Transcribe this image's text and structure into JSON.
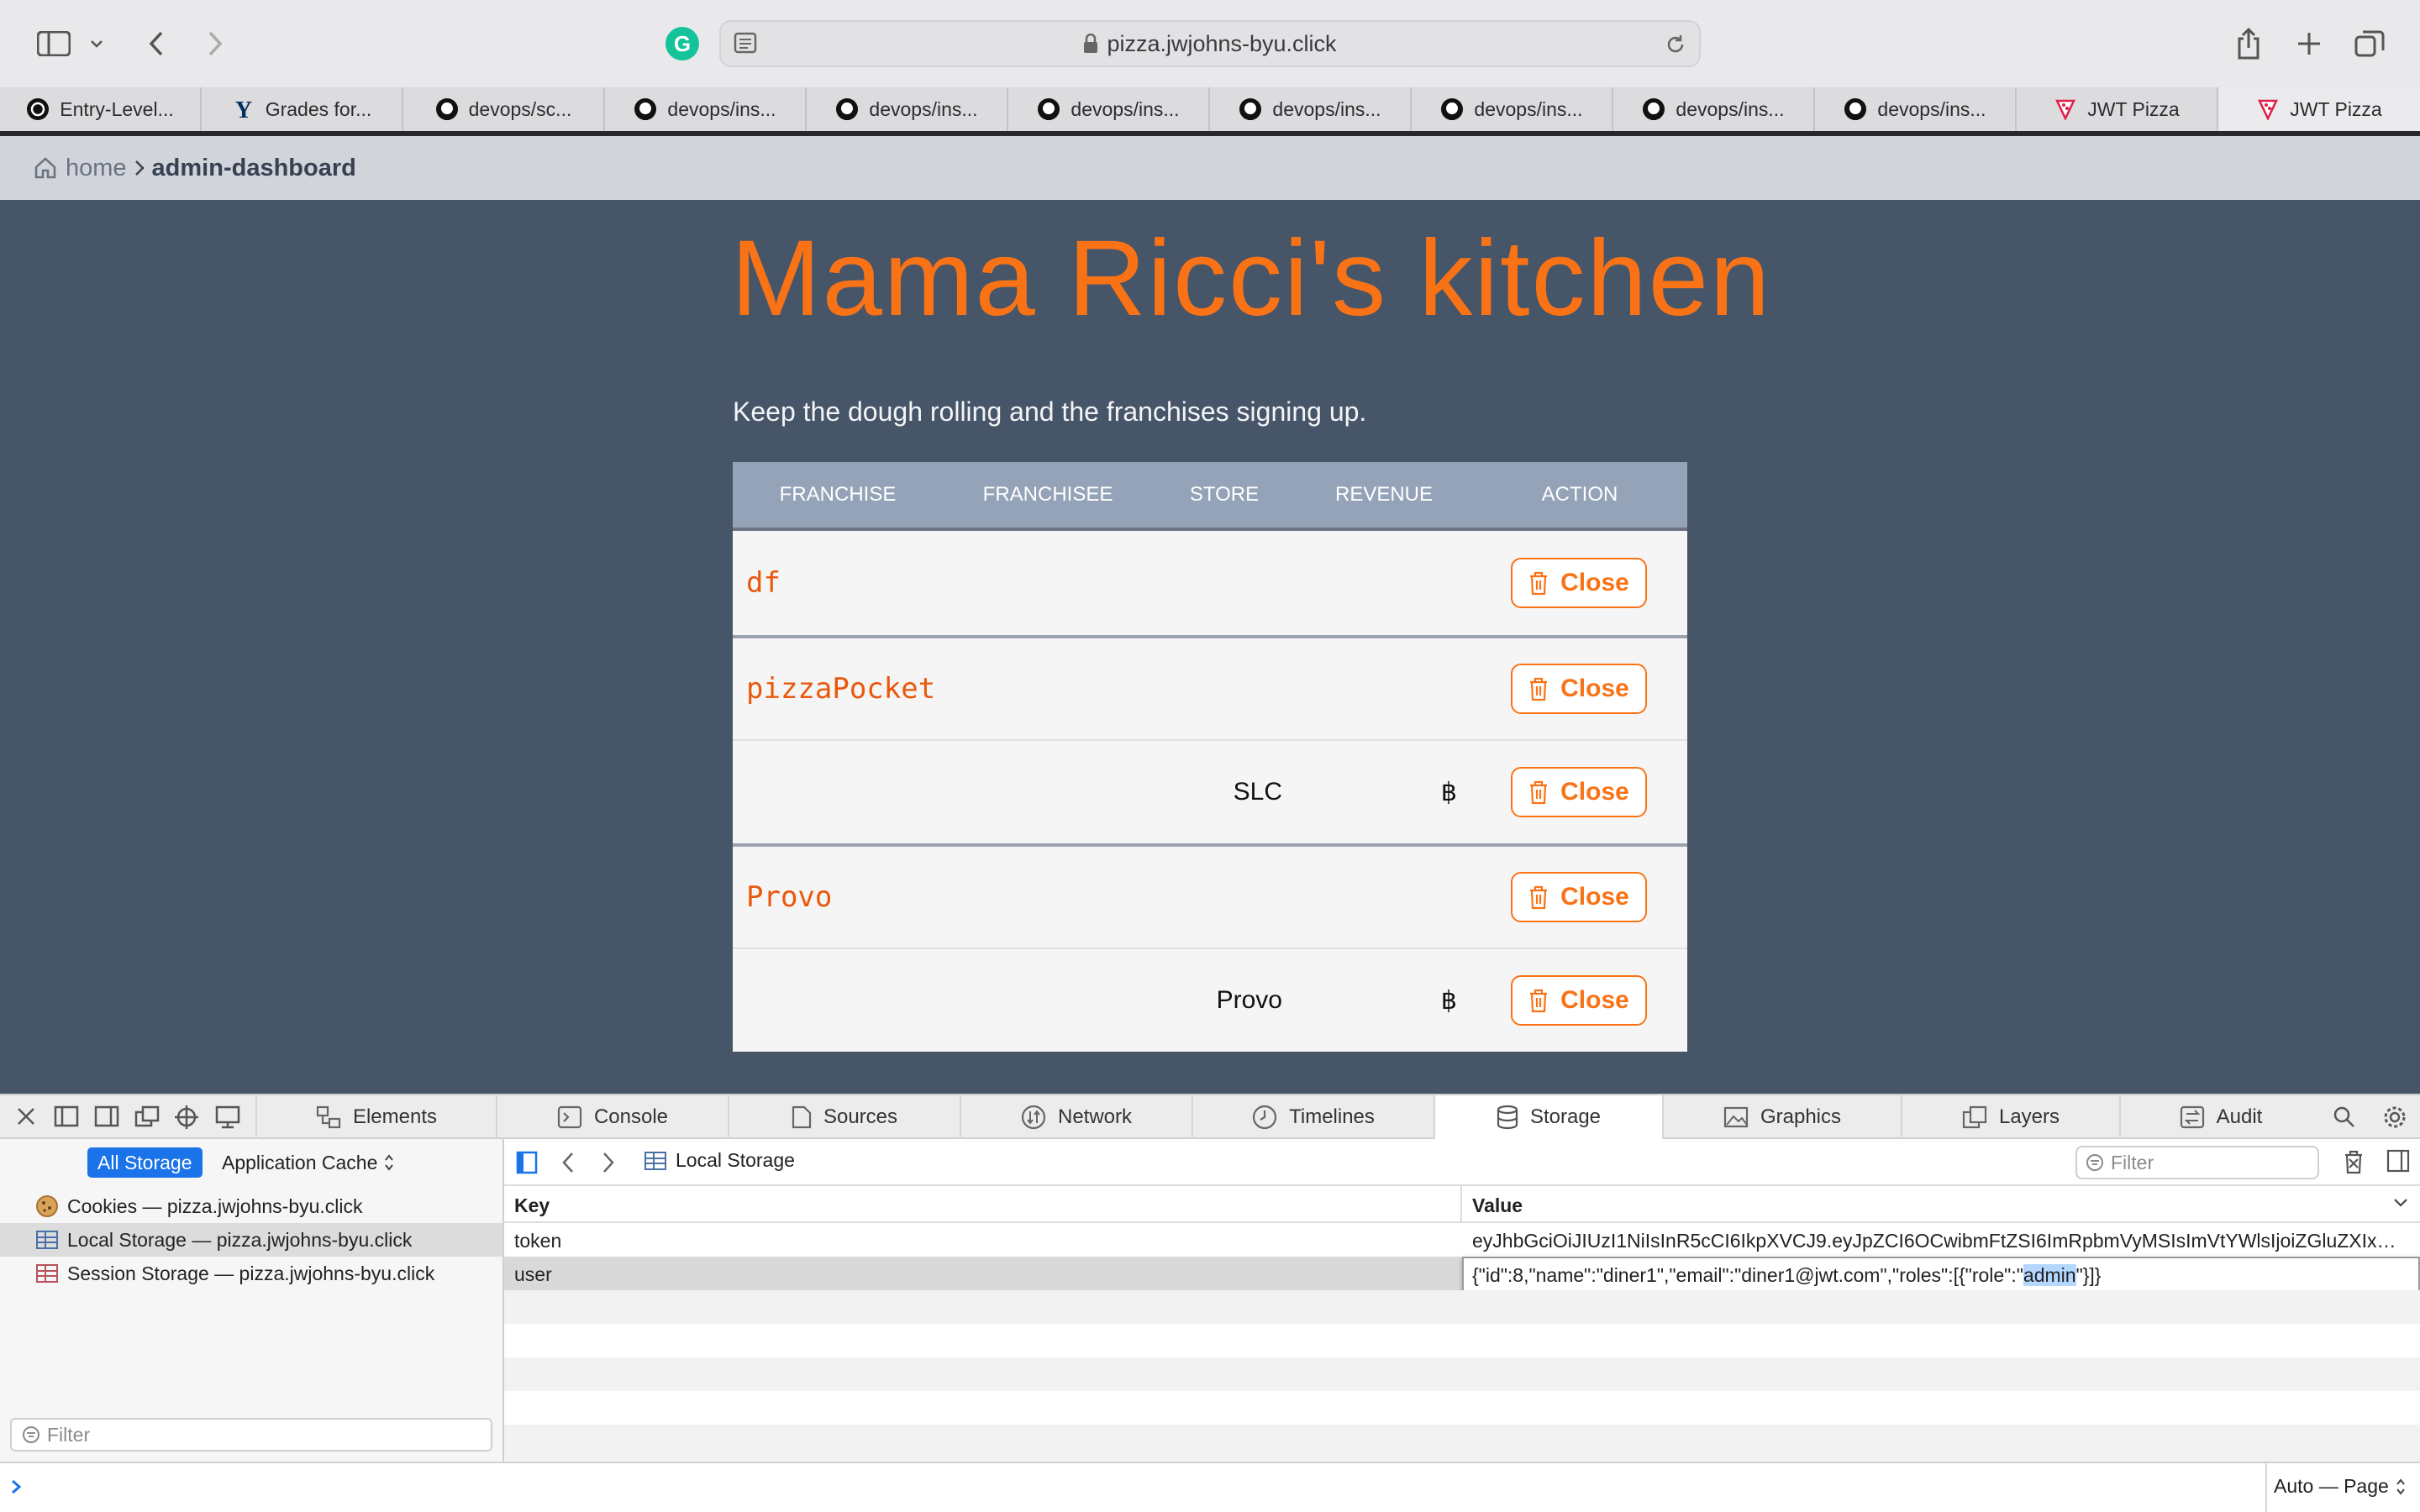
{
  "browser": {
    "url": "pizza.jwjohns-byu.click",
    "tabs": [
      {
        "label": "Entry-Level...",
        "icon": "openai-icon"
      },
      {
        "label": "Grades for...",
        "icon": "byu-y-icon"
      },
      {
        "label": "devops/sc...",
        "icon": "github-icon"
      },
      {
        "label": "devops/ins...",
        "icon": "github-icon"
      },
      {
        "label": "devops/ins...",
        "icon": "github-icon"
      },
      {
        "label": "devops/ins...",
        "icon": "github-icon"
      },
      {
        "label": "devops/ins...",
        "icon": "github-icon"
      },
      {
        "label": "devops/ins...",
        "icon": "github-icon"
      },
      {
        "label": "devops/ins...",
        "icon": "github-icon"
      },
      {
        "label": "devops/ins...",
        "icon": "github-icon"
      },
      {
        "label": "JWT Pizza",
        "icon": "pizza-icon"
      },
      {
        "label": "JWT Pizza",
        "icon": "pizza-icon"
      }
    ]
  },
  "breadcrumb": {
    "home": "home",
    "current": "admin-dashboard"
  },
  "page": {
    "title": "Mama Ricci's kitchen",
    "subtitle": "Keep the dough rolling and the franchises signing up.",
    "columns": [
      "FRANCHISE",
      "FRANCHISEE",
      "STORE",
      "REVENUE",
      "ACTION"
    ],
    "close_label": "Close",
    "franchises": [
      {
        "name": "df",
        "stores": []
      },
      {
        "name": "pizzaPocket",
        "stores": [
          {
            "store": "SLC",
            "revenue": "฿"
          }
        ]
      },
      {
        "name": "Provo",
        "stores": [
          {
            "store": "Provo",
            "revenue": "฿"
          }
        ]
      }
    ]
  },
  "devtools": {
    "tabs": [
      "Elements",
      "Console",
      "Sources",
      "Network",
      "Timelines",
      "Storage",
      "Graphics",
      "Layers",
      "Audit"
    ],
    "active_tab": "Storage",
    "storage_scope": "All Storage",
    "application_cache": "Application Cache",
    "sidebar_items": [
      {
        "label": "Cookies — pizza.jwjohns-byu.click",
        "icon": "cookie-icon"
      },
      {
        "label": "Local Storage — pizza.jwjohns-byu.click",
        "icon": "table-icon"
      },
      {
        "label": "Session Storage — pizza.jwjohns-byu.click",
        "icon": "table-icon"
      }
    ],
    "sidebar_filter_placeholder": "Filter",
    "content_title": "Local Storage",
    "filter_placeholder": "Filter",
    "key_header": "Key",
    "value_header": "Value",
    "rows": [
      {
        "key": "token",
        "value": "eyJhbGciOiJIUzI1NiIsInR5cCI6IkpXVCJ9.eyJpZCI6OCwibmFtZSI6ImRpbmVyMSIsImVtYWlsIjoiZGluZXIxQ..."
      },
      {
        "key": "user",
        "value_pre": "{\"id\":8,\"name\":\"diner1\",\"email\":\"diner1@jwt.com\",\"roles\":[{\"role\":\"",
        "value_sel": "admin",
        "value_post": "\"}]}"
      }
    ],
    "status_right": "Auto — Page"
  },
  "colors": {
    "accent": "#f97316",
    "main_bg": "#475569",
    "header_bg": "#94a3b8",
    "selection": "#b3d7ff"
  }
}
